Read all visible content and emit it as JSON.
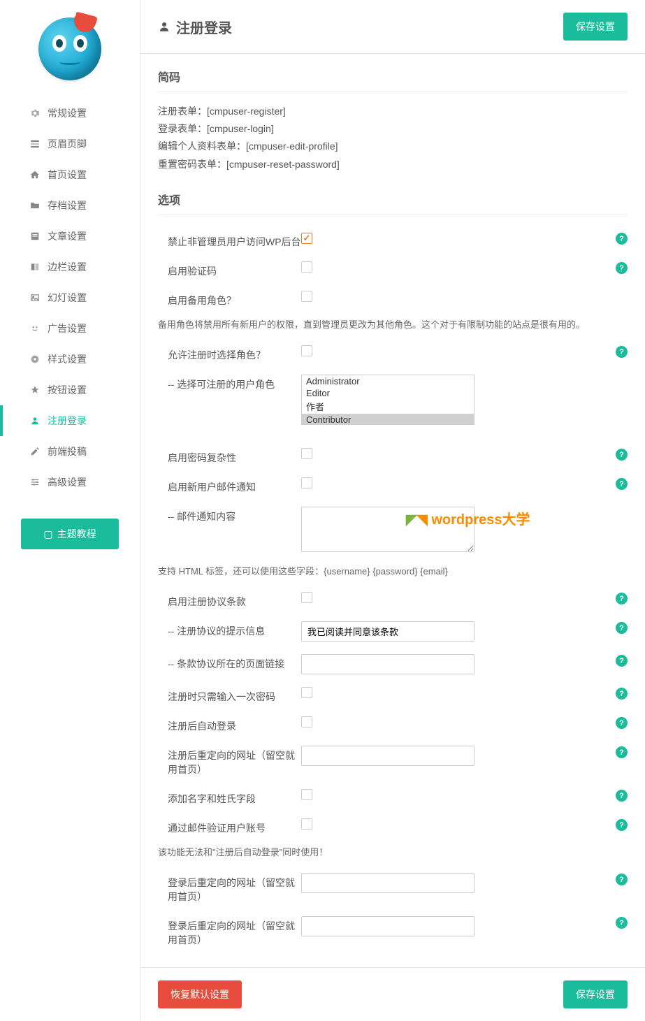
{
  "sidebar": {
    "items": [
      {
        "label": "常规设置"
      },
      {
        "label": "页眉页脚"
      },
      {
        "label": "首页设置"
      },
      {
        "label": "存档设置"
      },
      {
        "label": "文章设置"
      },
      {
        "label": "边栏设置"
      },
      {
        "label": "幻灯设置"
      },
      {
        "label": "广告设置"
      },
      {
        "label": "样式设置"
      },
      {
        "label": "按钮设置"
      },
      {
        "label": "注册登录"
      },
      {
        "label": "前端投稿"
      },
      {
        "label": "高级设置"
      }
    ],
    "theme_button": "主题教程"
  },
  "header": {
    "title": "注册登录",
    "save_label": "保存设置"
  },
  "sections": {
    "shortcode_title": "简码",
    "options_title": "选项"
  },
  "shortcodes": {
    "register": "注册表单：[cmpuser-register]",
    "login": "登录表单：[cmpuser-login]",
    "edit_profile": "编辑个人资料表单：[cmpuser-edit-profile]",
    "reset_password": "重置密码表单：[cmpuser-reset-password]"
  },
  "options": {
    "block_nonadmin_label": "禁止非管理员用户访问WP后台",
    "enable_captcha_label": "启用验证码",
    "enable_backup_role_label": "启用备用角色？",
    "backup_role_note": "备用角色将禁用所有新用户的权限，直到管理员更改为其他角色。这个对于有限制功能的站点是很有用的。",
    "allow_role_select_label": "允许注册时选择角色？",
    "select_roles_label": "-- 选择可注册的用户角色",
    "roles": [
      "Administrator",
      "Editor",
      "作者",
      "Contributor"
    ],
    "enable_password_complexity_label": "启用密码复杂性",
    "enable_new_user_email_label": "启用新用户邮件通知",
    "email_content_label": "-- 邮件通知内容",
    "email_content_note": "支持 HTML 标签，还可以使用这些字段：{username} {password} {email}",
    "enable_terms_label": "启用注册协议条款",
    "terms_hint_label": "-- 注册协议的提示信息",
    "terms_hint_value": "我已阅读并同意该条款",
    "terms_link_label": "-- 条款协议所在的页面链接",
    "single_password_label": "注册时只需输入一次密码",
    "auto_login_label": "注册后自动登录",
    "register_redirect_label": "注册后重定向的网址（留空就用首页）",
    "add_name_fields_label": "添加名字和姓氏字段",
    "email_verify_label": "通过邮件验证用户账号",
    "email_verify_note": "该功能无法和\"注册后自动登录\"同时使用！",
    "login_redirect1_label": "登录后重定向的网址（留空就用首页）",
    "login_redirect2_label": "登录后重定向的网址（留空就用首页）"
  },
  "footer": {
    "reset_label": "恢复默认设置",
    "save_label": "保存设置"
  },
  "watermark": "wordpress大学"
}
